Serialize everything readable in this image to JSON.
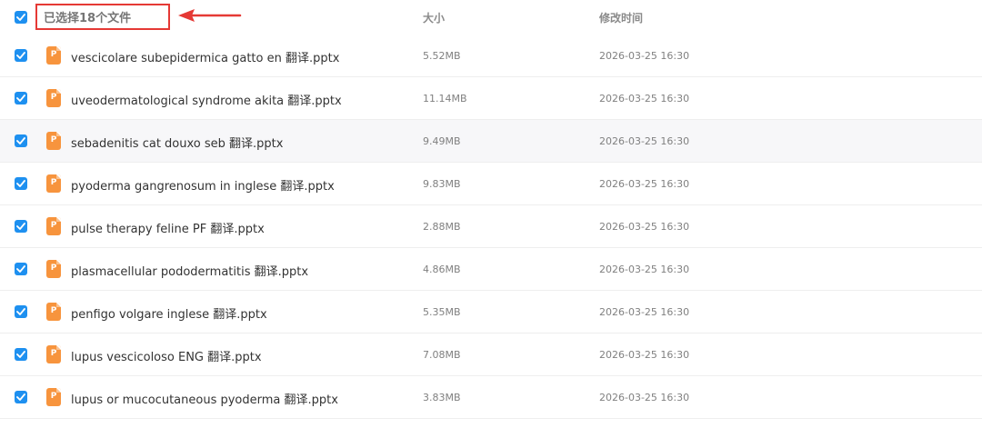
{
  "header": {
    "selection_label": "已选择18个文件",
    "columns": {
      "size": "大小",
      "modified": "修改时间"
    },
    "select_all_checked": true
  },
  "file_icon_glyph": "P",
  "colors": {
    "accent": "#1e90f0",
    "file_icon": "#f7943d",
    "annotation_red": "#e53935"
  },
  "files": [
    {
      "name": "vescicolare subepidermica gatto en 翻译.pptx",
      "size": "5.52MB",
      "modified": "2026-03-25 16:30",
      "checked": true
    },
    {
      "name": "uveodermatological syndrome akita 翻译.pptx",
      "size": "11.14MB",
      "modified": "2026-03-25 16:30",
      "checked": true
    },
    {
      "name": "sebadenitis cat douxo seb 翻译.pptx",
      "size": "9.49MB",
      "modified": "2026-03-25 16:30",
      "checked": true
    },
    {
      "name": "pyoderma gangrenosum in inglese 翻译.pptx",
      "size": "9.83MB",
      "modified": "2026-03-25 16:30",
      "checked": true
    },
    {
      "name": "pulse therapy feline PF 翻译.pptx",
      "size": "2.88MB",
      "modified": "2026-03-25 16:30",
      "checked": true
    },
    {
      "name": "plasmacellular pododermatitis 翻译.pptx",
      "size": "4.86MB",
      "modified": "2026-03-25 16:30",
      "checked": true
    },
    {
      "name": "penfigo volgare inglese 翻译.pptx",
      "size": "5.35MB",
      "modified": "2026-03-25 16:30",
      "checked": true
    },
    {
      "name": "lupus vescicoloso ENG 翻译.pptx",
      "size": "7.08MB",
      "modified": "2026-03-25 16:30",
      "checked": true
    },
    {
      "name": "lupus or mucocutaneous pyoderma 翻译.pptx",
      "size": "3.83MB",
      "modified": "2026-03-25 16:30",
      "checked": true
    }
  ]
}
